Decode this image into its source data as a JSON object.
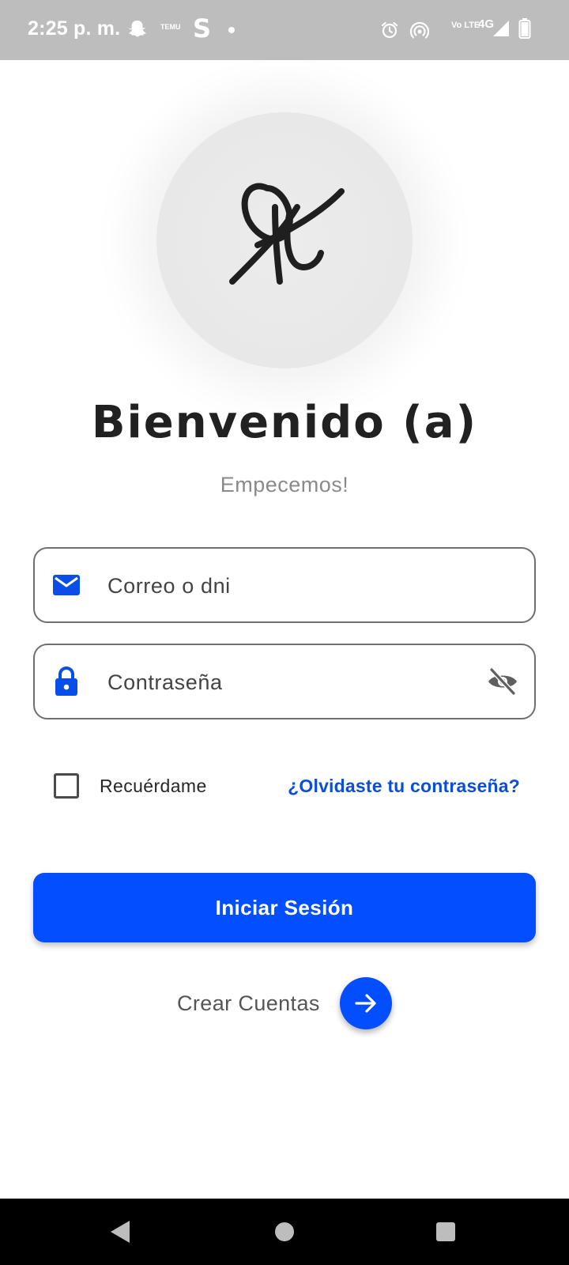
{
  "status_bar": {
    "time": "2:25 p. m.",
    "temu_label": "TEMU",
    "s_app_letter": "S",
    "volte_label": "Vo LTE",
    "network_label": "4G",
    "icons": [
      "snapchat-icon",
      "temu-icon",
      "s-app-icon",
      "dot-icon",
      "alarm-icon",
      "hotspot-icon",
      "volte-icon",
      "signal-icon",
      "battery-icon"
    ]
  },
  "logo": {
    "icon": "signature-logo-icon"
  },
  "header": {
    "title": "Bienvenido (a)",
    "subtitle": "Empecemos!"
  },
  "form": {
    "email": {
      "placeholder": "Correo o dni",
      "icon": "mail-icon"
    },
    "password": {
      "placeholder": "Contraseña",
      "icon": "lock-icon",
      "toggle_icon": "eye-off-icon"
    },
    "remember_label": "Recuérdame",
    "remember_checked": false,
    "forgot_label": "¿Olvidaste tu contraseña?"
  },
  "actions": {
    "login_label": "Iniciar Sesión",
    "create_label": "Crear Cuentas",
    "create_icon": "arrow-right-icon"
  },
  "nav_bar": {
    "icons": [
      "back-icon",
      "home-icon",
      "recents-icon"
    ]
  },
  "colors": {
    "accent": "#034fff",
    "link": "#0b4ed8",
    "status_bar": "#bdbdbd",
    "title_text": "#212121"
  }
}
